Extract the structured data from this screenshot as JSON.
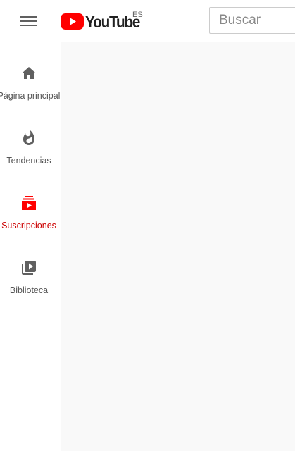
{
  "colors": {
    "brand_red": "#ff0000",
    "active_red": "#cc0000",
    "icon_gray": "#606060",
    "text_dark": "#212121"
  },
  "header": {
    "menu_icon": "hamburger-menu-icon",
    "logo_text": "YouTube",
    "country_code": "ES",
    "search": {
      "placeholder": "Buscar",
      "value": ""
    }
  },
  "sidebar": {
    "items": [
      {
        "label": "Página principal",
        "icon": "home-icon",
        "active": false
      },
      {
        "label": "Tendencias",
        "icon": "flame-icon",
        "active": false
      },
      {
        "label": "Suscripciones",
        "icon": "subscriptions-icon",
        "active": true
      },
      {
        "label": "Biblioteca",
        "icon": "library-icon",
        "active": false
      }
    ]
  }
}
